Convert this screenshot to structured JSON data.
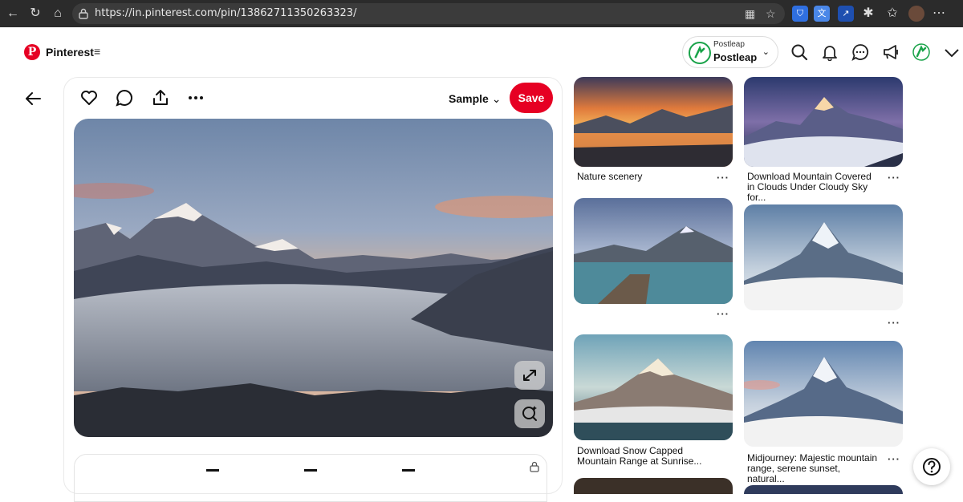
{
  "browser": {
    "url": "https://in.pinterest.com/pin/13862711350263323/"
  },
  "header": {
    "brand": "Pinterest",
    "menu_glyph": "≡",
    "account": {
      "top_label": "Postleap",
      "name": "Postleap"
    }
  },
  "pin": {
    "board_name": "Sample",
    "save_label": "Save"
  },
  "related": [
    {
      "title": "Nature scenery"
    },
    {
      "title": "Download Mountain Covered in Clouds Under Cloudy Sky for..."
    },
    {
      "title": ""
    },
    {
      "title": ""
    },
    {
      "title": "Download Snow Capped Mountain Range at Sunrise..."
    },
    {
      "title": "Midjourney: Majestic mountain range, serene sunset, natural..."
    }
  ],
  "icons": {
    "back": "arrow-left-icon",
    "like": "heart-icon",
    "comment": "comment-icon",
    "share": "share-icon",
    "more": "more-icon",
    "search": "search-icon",
    "notifications": "bell-icon",
    "messages": "chat-icon",
    "updates": "megaphone-icon",
    "expand": "expand-icon",
    "visual_search": "visual-search-icon",
    "help": "help-icon"
  },
  "colors": {
    "brand": "#e60023"
  }
}
